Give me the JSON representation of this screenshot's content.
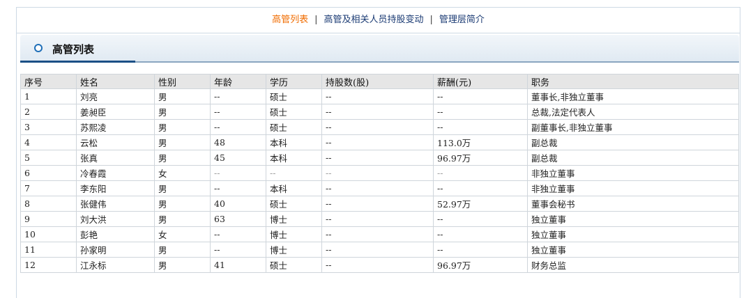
{
  "nav": {
    "links": [
      "高管列表",
      "高管及相关人员持股变动",
      "管理层简介"
    ],
    "separator": "|"
  },
  "section": {
    "title": "高管列表"
  },
  "table": {
    "headers": [
      "序号",
      "姓名",
      "性别",
      "年龄",
      "学历",
      "持股数(股)",
      "薪酬(元)",
      "职务"
    ],
    "rows": [
      [
        "1",
        "刘亮",
        "男",
        "--",
        "硕士",
        "--",
        "--",
        "董事长,非独立董事"
      ],
      [
        "2",
        "姜昶臣",
        "男",
        "--",
        "硕士",
        "--",
        "--",
        "总裁,法定代表人"
      ],
      [
        "3",
        "苏熙凌",
        "男",
        "--",
        "硕士",
        "--",
        "--",
        "副董事长,非独立董事"
      ],
      [
        "4",
        "云松",
        "男",
        "48",
        "本科",
        "--",
        "113.0万",
        "副总裁"
      ],
      [
        "5",
        "张真",
        "男",
        "45",
        "本科",
        "--",
        "96.97万",
        "副总裁"
      ],
      [
        "6",
        "冷春霞",
        "女",
        "--",
        "--",
        "--",
        "--",
        "非独立董事"
      ],
      [
        "7",
        "李东阳",
        "男",
        "--",
        "本科",
        "--",
        "--",
        "非独立董事"
      ],
      [
        "8",
        "张健伟",
        "男",
        "40",
        "硕士",
        "--",
        "52.97万",
        "董事会秘书"
      ],
      [
        "9",
        "刘大洪",
        "男",
        "63",
        "博士",
        "--",
        "--",
        "独立董事"
      ],
      [
        "10",
        "彭艳",
        "女",
        "--",
        "博士",
        "--",
        "--",
        "独立董事"
      ],
      [
        "11",
        "孙家明",
        "男",
        "--",
        "博士",
        "--",
        "--",
        "独立董事"
      ],
      [
        "12",
        "江永标",
        "男",
        "41",
        "硕士",
        "--",
        "96.97万",
        "财务总监"
      ]
    ]
  }
}
